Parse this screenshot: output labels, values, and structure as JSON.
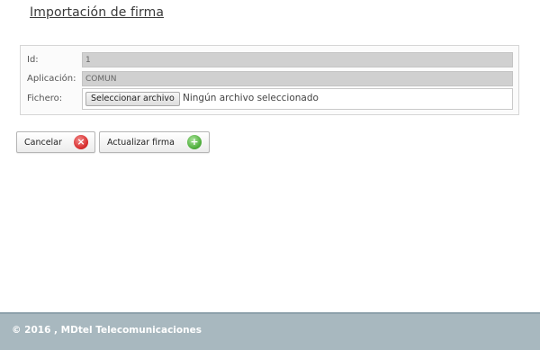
{
  "page": {
    "title": "Importación de firma"
  },
  "form": {
    "id": {
      "label": "Id:",
      "value": "1"
    },
    "aplicacion": {
      "label": "Aplicación:",
      "value": "COMUN"
    },
    "fichero": {
      "label": "Fichero:",
      "button_label": "Seleccionar archivo",
      "status": "Ningún archivo seleccionado"
    }
  },
  "actions": {
    "cancel_label": "Cancelar",
    "update_label": "Actualizar firma",
    "cancel_icon": "close-icon",
    "update_icon": "plus-icon"
  },
  "footer": {
    "text": "© 2016 , MDtel Telecomunicaciones"
  },
  "colors": {
    "footer_bg": "#a8b8bf",
    "cancel_icon": "#d82e2e",
    "add_icon": "#4fae3c"
  }
}
